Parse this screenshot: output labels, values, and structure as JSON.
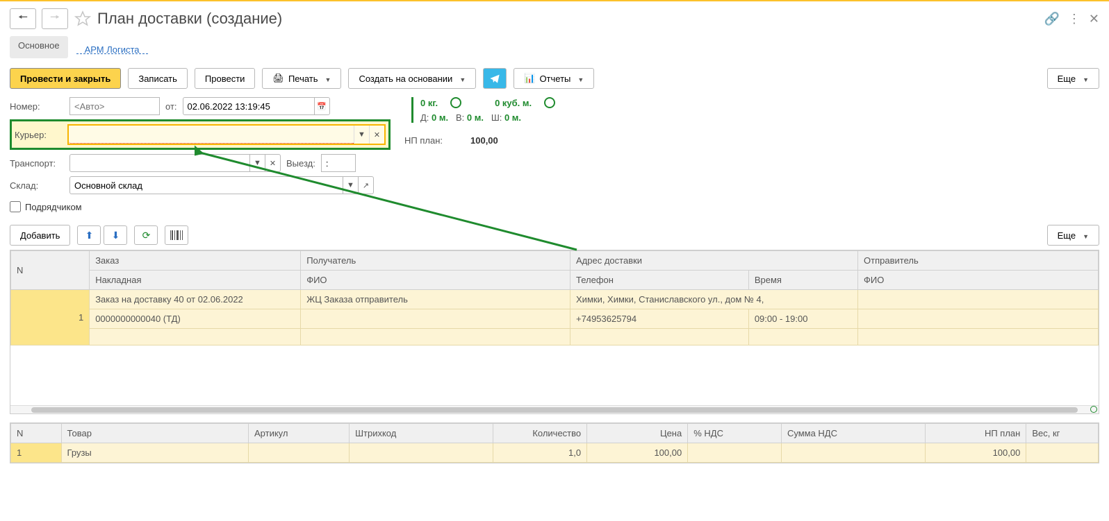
{
  "header": {
    "title": "План доставки (создание)"
  },
  "tabs": {
    "main": "Основное",
    "arm": "АРМ Логиста"
  },
  "toolbar": {
    "post_close": "Провести и закрыть",
    "save": "Записать",
    "post": "Провести",
    "print": "Печать",
    "create_based": "Создать на основании",
    "reports": "Отчеты",
    "more": "Еще"
  },
  "fields": {
    "number_label": "Номер:",
    "number_placeholder": "<Авто>",
    "date_label": "от:",
    "date_value": "02.06.2022 13:19:45",
    "courier_label": "Курьер:",
    "courier_value": "",
    "transport_label": "Транспорт:",
    "transport_value": "",
    "departure_label": "Выезд:",
    "departure_value": ":",
    "warehouse_label": "Склад:",
    "warehouse_value": "Основной склад",
    "contractor_label": "Подрядчиком"
  },
  "stats": {
    "weight": "0 кг.",
    "volume": "0 куб. м.",
    "d_label": "Д:",
    "d_val": "0 м.",
    "v_label": "В:",
    "v_val": "0 м.",
    "sh_label": "Ш:",
    "sh_val": "0 м.",
    "np_label": "НП план:",
    "np_value": "100,00"
  },
  "table_toolbar": {
    "add": "Добавить",
    "more": "Еще"
  },
  "table1": {
    "headers": {
      "n": "N",
      "order": "Заказ",
      "recipient": "Получатель",
      "address": "Адрес доставки",
      "sender": "Отправитель",
      "invoice": "Накладная",
      "fio": "ФИО",
      "phone": "Телефон",
      "time": "Время",
      "fio2": "ФИО"
    },
    "rows": [
      {
        "n": "1",
        "order": "Заказ на доставку 40 от 02.06.2022",
        "recipient": "ЖЦ Заказа отправитель",
        "address": "Химки, Химки, Станиславского ул., дом № 4,",
        "sender": "",
        "invoice": "0000000000040 (ТД)",
        "fio": "",
        "phone": "+74953625794",
        "time": "09:00 - 19:00",
        "fio2": ""
      }
    ]
  },
  "table2": {
    "headers": {
      "n": "N",
      "product": "Товар",
      "article": "Артикул",
      "barcode": "Штрихкод",
      "qty": "Количество",
      "price": "Цена",
      "vat": "% НДС",
      "vat_sum": "Сумма НДС",
      "np_plan": "НП план",
      "weight": "Вес, кг"
    },
    "rows": [
      {
        "n": "1",
        "product": "Грузы",
        "article": "",
        "barcode": "",
        "qty": "1,0",
        "price": "100,00",
        "vat": "",
        "vat_sum": "",
        "np_plan": "100,00",
        "weight": ""
      }
    ]
  }
}
